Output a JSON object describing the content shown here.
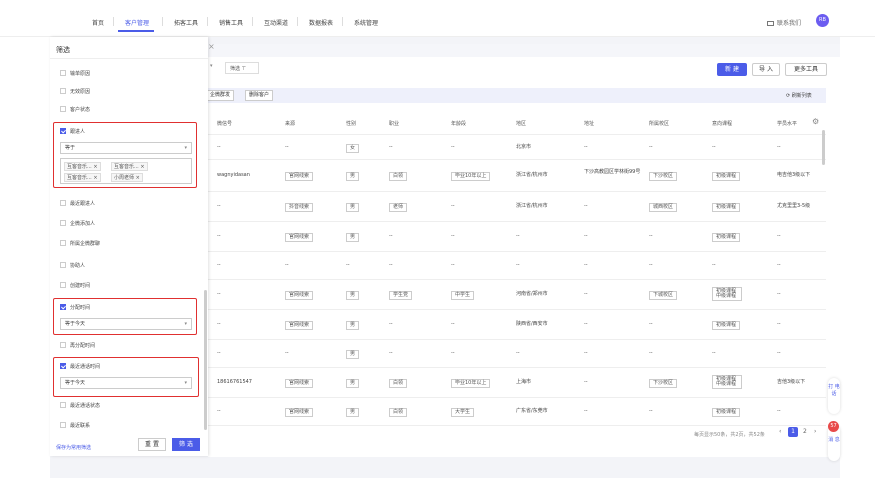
{
  "nav": {
    "items": [
      "首页",
      "客户管理",
      "拓客工具",
      "销售工具",
      "互动渠道",
      "数据报表",
      "系统管理"
    ],
    "active": "客户管理",
    "contact": "联系我们",
    "avatar": "RB"
  },
  "filter_panel": {
    "title": "筛选",
    "items_top": [
      "输单原因",
      "无效原因",
      "客户状态"
    ],
    "follower": {
      "label": "跟进人",
      "checked": true,
      "operator": "等于",
      "chips": [
        "互客音乐... ×",
        "互客音乐... ×",
        "互客音乐... ×",
        "小周老师 ×"
      ]
    },
    "items_mid": [
      "最近跟进人",
      "企微添加人",
      "所属企微群聊",
      "协助人",
      "创建时间"
    ],
    "assign_time": {
      "label": "分配时间",
      "checked": true,
      "value": "等于今天"
    },
    "reassign": "再分配时间",
    "last_contact": {
      "label": "最近通话时间",
      "checked": true,
      "value": "等于今天"
    },
    "items_bottom": [
      "最近通话状态",
      "最近联系"
    ],
    "save_link": "保存为常用筛选",
    "reset": "重 置",
    "apply": "筛 选"
  },
  "toolbar": {
    "select_caret": "▾",
    "filter_label": "筛选 ⊤",
    "new": "新 建",
    "import": "导 入",
    "tools": "更多工具",
    "bulk": [
      "企微群发",
      "删除客户"
    ],
    "refresh": "⟳ 刷新列表"
  },
  "table": {
    "headers": [
      "微信号",
      "来源",
      "性别",
      "职业",
      "年龄段",
      "地区",
      "地址",
      "所属校区",
      "意向课程",
      "学员水平"
    ],
    "rows": [
      {
        "wechat": "--",
        "source": "--",
        "gender": "女",
        "job": "--",
        "age": "--",
        "region": "北京市",
        "address": "--",
        "campus": "--",
        "course": "--",
        "level": "--"
      },
      {
        "wechat": "wagnyidasan",
        "source": "官网线索",
        "gender": "男",
        "job": "白领",
        "age": "毕业10年以上",
        "region": "浙江省/杭州市",
        "address": "下沙高教园区学林街99号",
        "campus": "下沙校区",
        "course": "初级课程",
        "level": "电吉他3级以下"
      },
      {
        "wechat": "--",
        "source": "抖音线索",
        "gender": "男",
        "job": "老师",
        "age": "--",
        "region": "浙江省/杭州市",
        "address": "--",
        "campus": "城西校区",
        "course": "初级课程",
        "level": "尤克里里3-5级"
      },
      {
        "wechat": "--",
        "source": "官网线索",
        "gender": "男",
        "job": "--",
        "age": "--",
        "region": "--",
        "address": "--",
        "campus": "--",
        "course": "初级课程",
        "level": "--"
      },
      {
        "wechat": "--",
        "source": "--",
        "gender": "--",
        "job": "--",
        "age": "--",
        "region": "--",
        "address": "--",
        "campus": "--",
        "course": "--",
        "level": "--"
      },
      {
        "wechat": "--",
        "source": "官网线索",
        "gender": "男",
        "job": "学生党",
        "age": "中学生",
        "region": "河南省/郑州市",
        "address": "--",
        "campus": "下城校区",
        "course": "初级课程 中级课程",
        "level": "--"
      },
      {
        "wechat": "--",
        "source": "官网线索",
        "gender": "男",
        "job": "--",
        "age": "--",
        "region": "陕西省/西安市",
        "address": "--",
        "campus": "--",
        "course": "初级课程",
        "level": "--"
      },
      {
        "wechat": "--",
        "source": "--",
        "gender": "男",
        "job": "--",
        "age": "--",
        "region": "--",
        "address": "--",
        "campus": "--",
        "course": "--",
        "level": "--"
      },
      {
        "wechat": "18616761547",
        "source": "官网线索",
        "gender": "男",
        "job": "白领",
        "age": "毕业10年以上",
        "region": "上海市",
        "address": "--",
        "campus": "下沙校区",
        "course": "初级课程 中级课程",
        "level": "吉他3级以下"
      },
      {
        "wechat": "--",
        "source": "官网线索",
        "gender": "男",
        "job": "白领",
        "age": "大学生",
        "region": "广东省/东莞市",
        "address": "--",
        "campus": "--",
        "course": "初级课程",
        "level": "--"
      }
    ]
  },
  "pager": {
    "summary": "每页显示50条，共2页，共52条",
    "prev": "‹",
    "page1": "1",
    "page2": "2",
    "next": "›"
  },
  "floating": {
    "call": "打 电 话",
    "msg": "消 息",
    "badge": "57"
  }
}
